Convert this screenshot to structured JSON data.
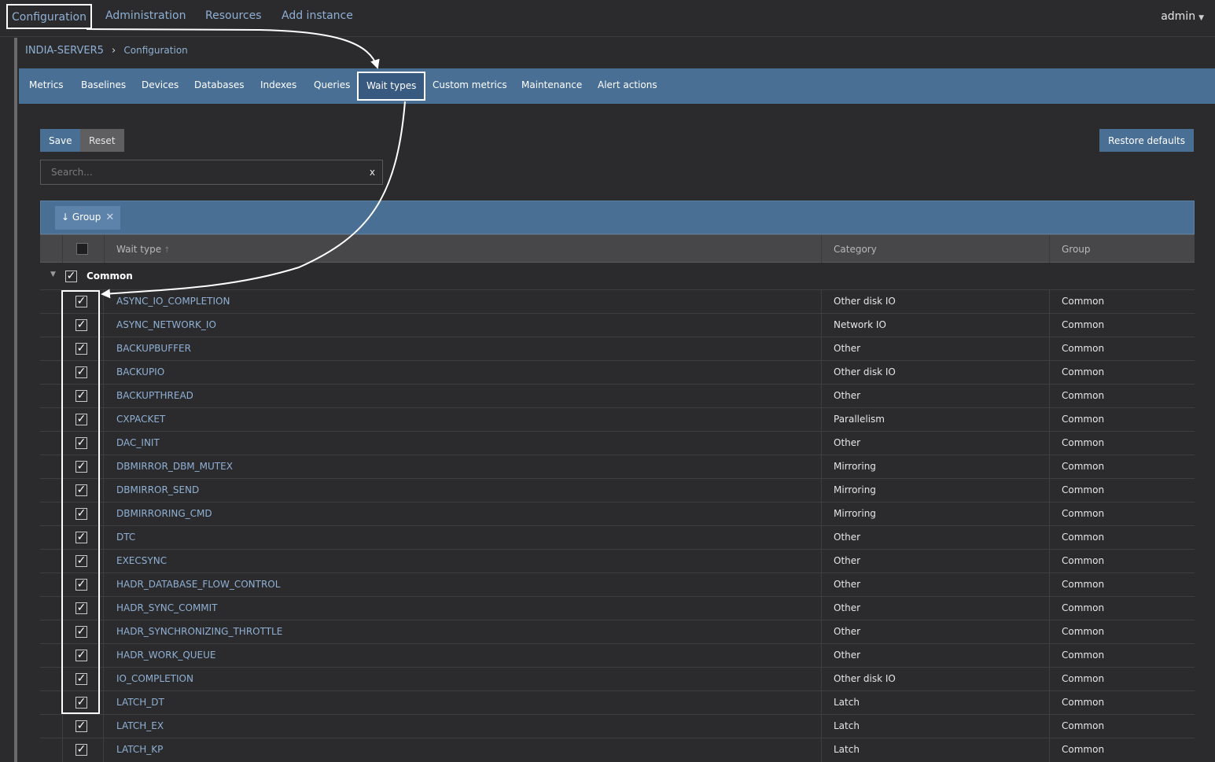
{
  "topnav": {
    "items": [
      "Configuration",
      "Administration",
      "Resources",
      "Add instance"
    ],
    "user": "admin",
    "user_caret_icon": "caret-down-icon"
  },
  "breadcrumb": {
    "host": "INDIA-SERVER5",
    "current": "Configuration"
  },
  "subnav": {
    "tabs": [
      "Metrics",
      "Baselines",
      "Devices",
      "Databases",
      "Indexes",
      "Queries",
      "Wait types",
      "Custom metrics",
      "Maintenance",
      "Alert actions"
    ],
    "active_tab": "Wait types"
  },
  "toolbar": {
    "save_label": "Save",
    "reset_label": "Reset",
    "restore_label": "Restore defaults"
  },
  "search": {
    "placeholder": "Search...",
    "value": "",
    "clear_glyph": "x"
  },
  "grouping": {
    "chip_label": "↓ Group",
    "chip_remove_glyph": "✕"
  },
  "table": {
    "columns": {
      "wait_type": "Wait type",
      "wait_type_sort": "↑",
      "category": "Category",
      "group": "Group"
    },
    "group_name": "Common",
    "check_glyph": "✓",
    "rows": [
      {
        "name": "ASYNC_IO_COMPLETION",
        "category": "Other disk IO",
        "group": "Common"
      },
      {
        "name": "ASYNC_NETWORK_IO",
        "category": "Network IO",
        "group": "Common"
      },
      {
        "name": "BACKUPBUFFER",
        "category": "Other",
        "group": "Common"
      },
      {
        "name": "BACKUPIO",
        "category": "Other disk IO",
        "group": "Common"
      },
      {
        "name": "BACKUPTHREAD",
        "category": "Other",
        "group": "Common"
      },
      {
        "name": "CXPACKET",
        "category": "Parallelism",
        "group": "Common"
      },
      {
        "name": "DAC_INIT",
        "category": "Other",
        "group": "Common"
      },
      {
        "name": "DBMIRROR_DBM_MUTEX",
        "category": "Mirroring",
        "group": "Common"
      },
      {
        "name": "DBMIRROR_SEND",
        "category": "Mirroring",
        "group": "Common"
      },
      {
        "name": "DBMIRRORING_CMD",
        "category": "Mirroring",
        "group": "Common"
      },
      {
        "name": "DTC",
        "category": "Other",
        "group": "Common"
      },
      {
        "name": "EXECSYNC",
        "category": "Other",
        "group": "Common"
      },
      {
        "name": "HADR_DATABASE_FLOW_CONTROL",
        "category": "Other",
        "group": "Common"
      },
      {
        "name": "HADR_SYNC_COMMIT",
        "category": "Other",
        "group": "Common"
      },
      {
        "name": "HADR_SYNCHRONIZING_THROTTLE",
        "category": "Other",
        "group": "Common"
      },
      {
        "name": "HADR_WORK_QUEUE",
        "category": "Other",
        "group": "Common"
      },
      {
        "name": "IO_COMPLETION",
        "category": "Other disk IO",
        "group": "Common"
      },
      {
        "name": "LATCH_DT",
        "category": "Latch",
        "group": "Common"
      },
      {
        "name": "LATCH_EX",
        "category": "Latch",
        "group": "Common"
      },
      {
        "name": "LATCH_KP",
        "category": "Latch",
        "group": "Common"
      }
    ]
  },
  "colors": {
    "accent": "#4a6f95",
    "link": "#8fb0d4",
    "background": "#2b2b2d"
  }
}
